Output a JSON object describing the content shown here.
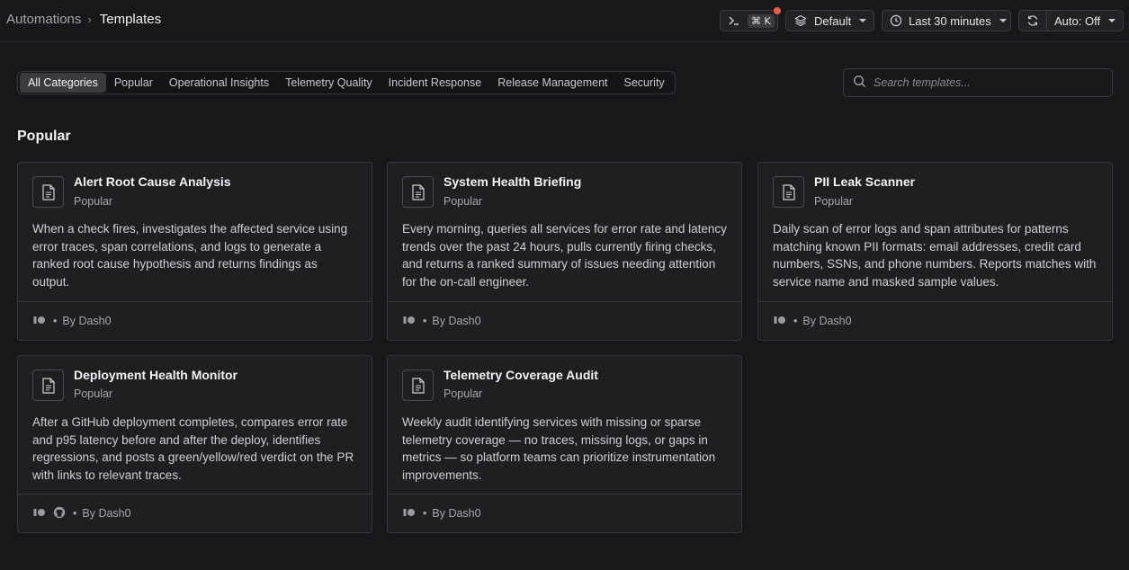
{
  "header": {
    "breadcrumb_parent": "Automations",
    "breadcrumb_separator": "›",
    "breadcrumb_current": "Templates",
    "command_shortcut": "⌘ K",
    "dataset_label": "Default",
    "time_range_label": "Last 30 minutes",
    "auto_refresh_label": "Auto: Off"
  },
  "tabs": [
    {
      "label": "All Categories",
      "active": true
    },
    {
      "label": "Popular"
    },
    {
      "label": "Operational Insights"
    },
    {
      "label": "Telemetry Quality"
    },
    {
      "label": "Incident Response"
    },
    {
      "label": "Release Management"
    },
    {
      "label": "Security"
    }
  ],
  "search": {
    "placeholder": "Search templates..."
  },
  "section": {
    "title": "Popular"
  },
  "cards": [
    {
      "title": "Alert Root Cause Analysis",
      "category": "Popular",
      "description": "When a check fires, investigates the affected service using error traces, span correlations, and logs to generate a ranked root cause hypothesis and returns findings as output.",
      "author": "By Dash0",
      "integrations": [
        "dash0-icon"
      ]
    },
    {
      "title": "System Health Briefing",
      "category": "Popular",
      "description": "Every morning, queries all services for error rate and latency trends over the past 24 hours, pulls currently firing checks, and returns a ranked summary of issues needing attention for the on-call engineer.",
      "author": "By Dash0",
      "integrations": [
        "dash0-icon"
      ]
    },
    {
      "title": "PII Leak Scanner",
      "category": "Popular",
      "description": "Daily scan of error logs and span attributes for patterns matching known PII formats: email addresses, credit card numbers, SSNs, and phone numbers. Reports matches with service name and masked sample values.",
      "author": "By Dash0",
      "integrations": [
        "dash0-icon"
      ]
    },
    {
      "title": "Deployment Health Monitor",
      "category": "Popular",
      "description": "After a GitHub deployment completes, compares error rate and p95 latency before and after the deploy, identifies regressions, and posts a green/yellow/red verdict on the PR with links to relevant traces.",
      "author": "By Dash0",
      "integrations": [
        "dash0-icon",
        "github-icon"
      ]
    },
    {
      "title": "Telemetry Coverage Audit",
      "category": "Popular",
      "description": "Weekly audit identifying services with missing or sparse telemetry coverage — no traces, missing logs, or gaps in metrics — so platform teams can prioritize instrumentation improvements.",
      "author": "By Dash0",
      "integrations": [
        "dash0-icon"
      ]
    }
  ],
  "colors": {
    "background": "#18181a",
    "card": "#1f1f22",
    "border": "#35353a",
    "notification": "#ef5b4a"
  }
}
